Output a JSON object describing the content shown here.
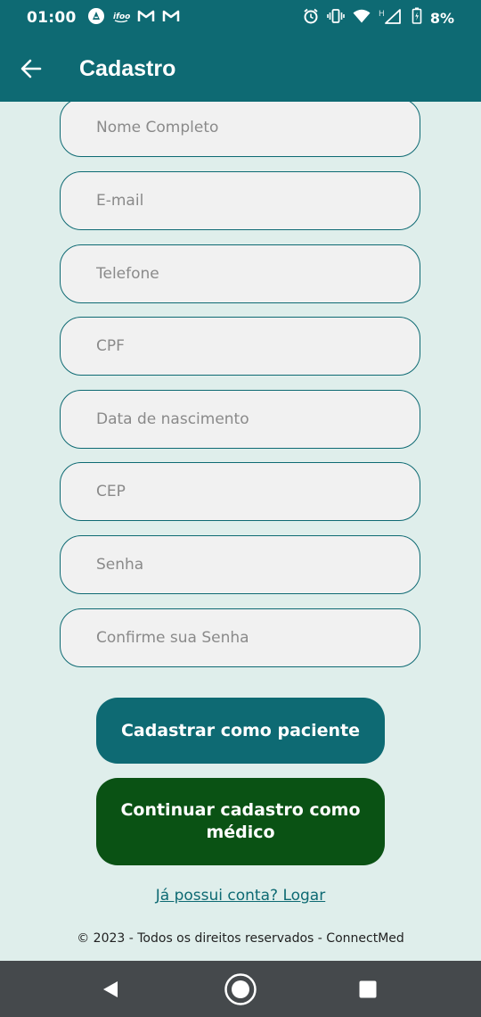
{
  "status_bar": {
    "time": "01:00",
    "battery": "8%",
    "icons_left": [
      "app-a-icon",
      "carrier-logo-icon",
      "gmail-icon",
      "gmail-icon"
    ],
    "icons_right": [
      "alarm-icon",
      "vibrate-icon",
      "wifi-icon",
      "h-signal-icon",
      "battery-icon"
    ]
  },
  "app_bar": {
    "title": "Cadastro",
    "back_icon": "arrow-left-icon"
  },
  "form": {
    "fields": [
      {
        "placeholder": "Nome Completo",
        "value": ""
      },
      {
        "placeholder": "E-mail",
        "value": ""
      },
      {
        "placeholder": "Telefone",
        "value": ""
      },
      {
        "placeholder": "CPF",
        "value": ""
      },
      {
        "placeholder": "Data de nascimento",
        "value": ""
      },
      {
        "placeholder": "CEP",
        "value": ""
      },
      {
        "placeholder": "Senha",
        "value": ""
      },
      {
        "placeholder": "Confirme sua Senha",
        "value": ""
      }
    ]
  },
  "buttons": {
    "patient": "Cadastrar como paciente",
    "doctor": "Continuar cadastro como médico"
  },
  "login_link": "Já possui conta? Logar",
  "footer": "© 2023 - Todos os direitos reservados - ConnectMed",
  "colors": {
    "primary": "#0e6a73",
    "doctor_button": "#0a5214",
    "background": "#dfeeeb",
    "field_bg": "#f1f1f1",
    "nav_bar": "#45494c"
  },
  "nav_bar": {
    "icons": [
      "back-triangle-icon",
      "home-circle-icon",
      "recents-square-icon"
    ]
  }
}
